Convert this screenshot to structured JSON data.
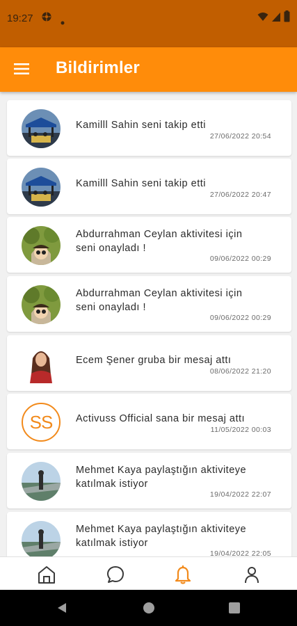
{
  "status_bar": {
    "time": "19:27"
  },
  "app_bar": {
    "title": "Bildirimler"
  },
  "notifications": [
    {
      "text": "Kamilll Sahin seni takip etti",
      "time": "27/06/2022 20:54"
    },
    {
      "text": "Kamilll Sahin seni takip etti",
      "time": "27/06/2022 20:47"
    },
    {
      "text_line1": "Abdurrahman  Ceylan aktivitesi için",
      "text_line2": "seni onayladı !",
      "time": "09/06/2022 00:29"
    },
    {
      "text_line1": "Abdurrahman  Ceylan aktivitesi için",
      "text_line2": "seni onayladı !",
      "time": "09/06/2022 00:29"
    },
    {
      "text": "Ecem Şener gruba bir mesaj attı",
      "time": "08/06/2022 21:20"
    },
    {
      "text": "Activuss Official sana bir mesaj attı",
      "time": "11/05/2022 00:03",
      "avatar_text": "SS"
    },
    {
      "text_line1": "Mehmet Kaya paylaştığın aktiviteye",
      "text_line2": "katılmak istiyor",
      "time": "19/04/2022 22:07"
    },
    {
      "text_line1": "Mehmet Kaya paylaştığın aktiviteye",
      "text_line2": "katılmak istiyor",
      "time": "19/04/2022 22:05"
    }
  ],
  "bottom_nav": {
    "items": [
      {
        "icon": "home-icon",
        "active": false
      },
      {
        "icon": "chat-icon",
        "active": false
      },
      {
        "icon": "bell-icon",
        "active": true
      },
      {
        "icon": "profile-icon",
        "active": false
      }
    ]
  },
  "colors": {
    "status_bar": "#c15e00",
    "app_bar": "#ff8c0a",
    "accent": "#f28a1b",
    "icon": "#3a3a3a"
  }
}
